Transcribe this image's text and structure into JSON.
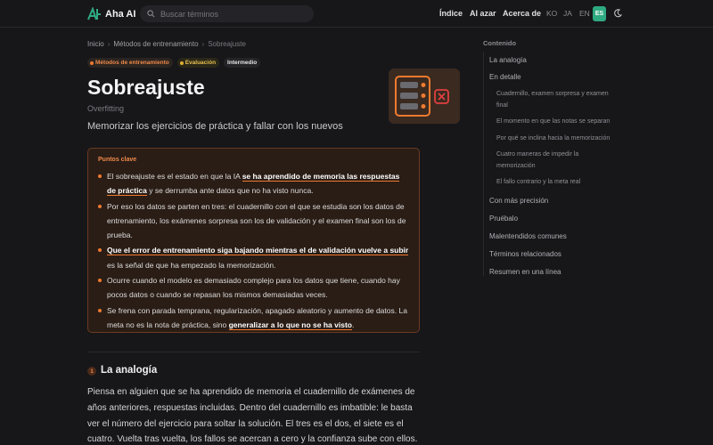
{
  "header": {
    "brand": "Aha AI",
    "search_placeholder": "Buscar términos",
    "nav": [
      "Índice",
      "AI azar",
      "Acerca de"
    ],
    "languages": [
      "KO",
      "JA",
      "EN"
    ],
    "active_language": "ES"
  },
  "breadcrumb": [
    "Inicio",
    "Métodos de entrenamiento",
    "Sobreajuste"
  ],
  "tags": {
    "category": "Métodos de entrenamiento",
    "evaluation": "Evaluación",
    "level": "Intermedio"
  },
  "article": {
    "title": "Sobreajuste",
    "english_term": "Overfitting",
    "lede": "Memorizar los ejercicios de práctica y fallar con los nuevos"
  },
  "key_points": {
    "title": "Puntos clave",
    "p1_a": "El sobreajuste es el estado en que la IA ",
    "p1_hl": "se ha aprendido de memoria las respuestas de práctica",
    "p1_b": " y se derrumba ante datos que no ha visto nunca.",
    "p2": "Por eso los datos se parten en tres: el cuadernillo con el que se estudia son los datos de entrenamiento, los exámenes sorpresa son los de validación y el examen final son los de prueba.",
    "p3_hl": "Que el error de entrenamiento siga bajando mientras el de validación vuelve a subir",
    "p3_b": " es la señal de que ha empezado la memorización.",
    "p4": "Ocurre cuando el modelo es demasiado complejo para los datos que tiene, cuando hay pocos datos o cuando se repasan los mismos demasiadas veces.",
    "p5_a": "Se frena con parada temprana, regularización, apagado aleatorio y aumento de datos. La meta no es la nota de práctica, sino ",
    "p5_hl": "generalizar a lo que no se ha visto",
    "p5_b": "."
  },
  "section1": {
    "number": "1",
    "title": "La analogía",
    "body": "Piensa en alguien que se ha aprendido de memoria el cuadernillo de exámenes de años anteriores, respuestas incluidas. Dentro del cuadernillo es imbatible: le basta ver el número del ejercicio para soltar la solución. El tres es el dos, el siete es el cuatro. Vuelta tras vuelta, los fallos se acercan a cero y la confianza sube con ellos. Pero llega"
  },
  "toc": {
    "title": "Contenido",
    "items": {
      "analogia": "La analogía",
      "detalle": "En detalle",
      "sub1": "Cuadernillo, examen sorpresa y examen final",
      "sub2": "El momento en que las notas se separan",
      "sub3": "Por qué se inclina hacia la memorización",
      "sub4": "Cuatro maneras de impedir la memorización",
      "sub5": "El fallo contrario y la meta real",
      "precision": "Con más precisión",
      "pruebalo": "Pruébalo",
      "malentendidos": "Malentendidos comunes",
      "relacionados": "Términos relacionados",
      "resumen": "Resumen en una línea"
    }
  },
  "colors": {
    "accent": "#f07a30",
    "brand_green": "#2eaa80",
    "background": "#17171a"
  }
}
